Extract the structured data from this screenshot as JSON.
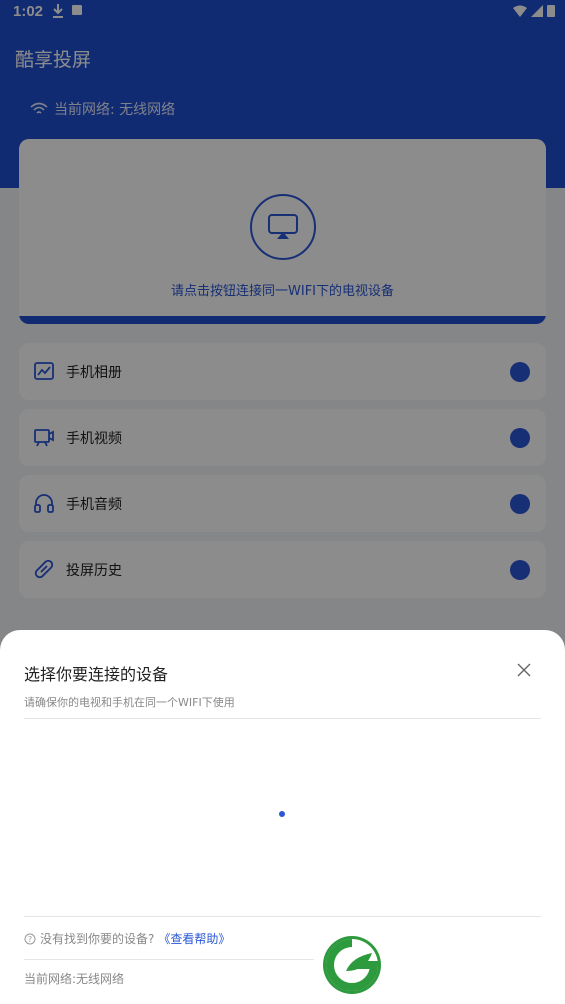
{
  "status_bar": {
    "time": "1:02"
  },
  "app": {
    "title": "酷享投屏",
    "network_label": "当前网络: 无线网络",
    "cast_hint": "请点击按钮连接同一WIFI下的电视设备",
    "menu": [
      {
        "label": "手机相册",
        "icon": "photo-icon"
      },
      {
        "label": "手机视频",
        "icon": "video-icon"
      },
      {
        "label": "手机音频",
        "icon": "headphones-icon"
      },
      {
        "label": "投屏历史",
        "icon": "history-icon"
      }
    ]
  },
  "sheet": {
    "title": "选择你要连接的设备",
    "subtitle": "请确保你的电视和手机在同一个WIFI下使用",
    "help_question": "没有找到你要的设备?",
    "help_link": "《查看帮助》",
    "network": "当前网络:无线网络"
  },
  "colors": {
    "primary": "#1f4fd0",
    "accent": "#2a57d6",
    "logo_green": "#2e9a3e"
  }
}
